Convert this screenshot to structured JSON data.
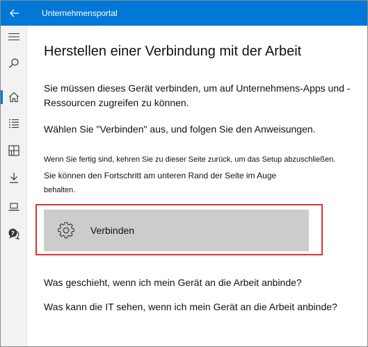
{
  "titlebar": {
    "app_title": "Unternehmensportal",
    "accent_color": "#0078d7"
  },
  "sidebar": {
    "items": [
      {
        "name": "menu",
        "icon": "hamburger-menu-icon"
      },
      {
        "name": "search",
        "icon": "search-icon"
      },
      {
        "name": "home",
        "icon": "home-icon",
        "active": true
      },
      {
        "name": "apps",
        "icon": "list-icon"
      },
      {
        "name": "categories",
        "icon": "grid-icon"
      },
      {
        "name": "downloads",
        "icon": "download-icon"
      },
      {
        "name": "devices",
        "icon": "laptop-icon"
      },
      {
        "name": "help",
        "icon": "help-chat-icon"
      }
    ]
  },
  "main": {
    "heading": "Herstellen einer Verbindung mit der Arbeit",
    "paragraph1": "Sie müssen dieses Gerät verbinden, um auf Unternehmens-Apps und -Ressourcen zugreifen zu können.",
    "paragraph2": "Wählen Sie \"Verbinden\" aus, und folgen Sie den Anweisungen.",
    "note_line1": "Wenn Sie fertig sind, kehren Sie zu dieser Seite zurück, um das Setup abzuschließen.",
    "note_line2": "Sie können den Fortschritt am unteren Rand der Seite im Auge",
    "note_line3": "behalten.",
    "connect_button_label": "Verbinden",
    "highlight_color": "#e0322b",
    "link1": "Was geschieht, wenn ich mein Gerät an die Arbeit anbinde?",
    "link2": "Was kann die IT sehen, wenn ich mein Gerät an die Arbeit anbinde?"
  }
}
